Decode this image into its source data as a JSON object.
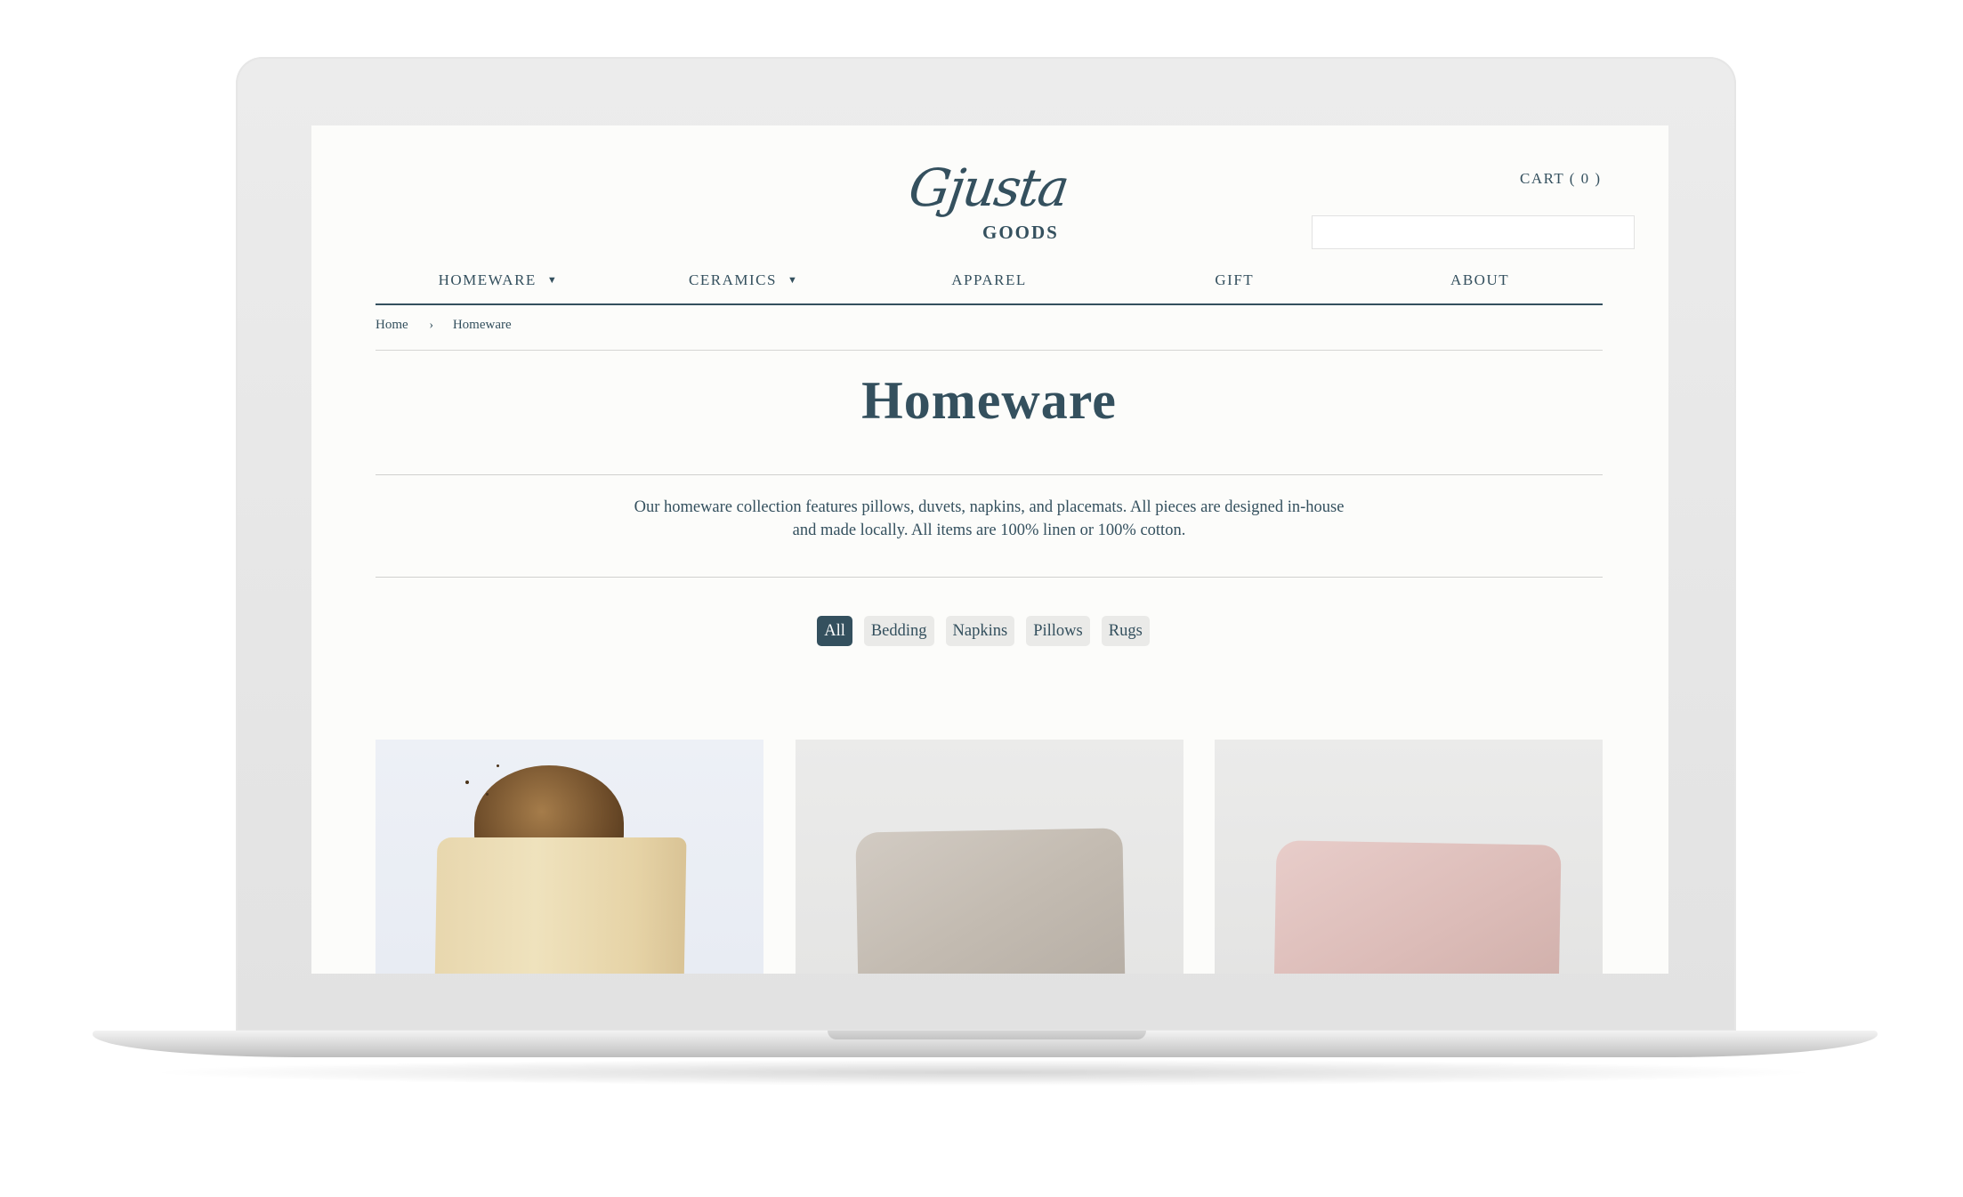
{
  "header": {
    "logo_script": "Gjusta",
    "logo_goods": "GOODS",
    "cart_label": "CART ( 0 )",
    "search_value": ""
  },
  "nav": {
    "items": [
      {
        "label": "HOMEWARE",
        "dropdown": true
      },
      {
        "label": "CERAMICS",
        "dropdown": true
      },
      {
        "label": "APPAREL",
        "dropdown": false
      },
      {
        "label": "GIFT",
        "dropdown": false
      },
      {
        "label": "ABOUT",
        "dropdown": false
      }
    ],
    "caret": "▼"
  },
  "breadcrumb": {
    "home": "Home",
    "separator": "›",
    "current": "Homeware"
  },
  "page": {
    "title": "Homeware",
    "description_line1": "Our homeware collection features pillows, duvets, napkins, and placemats. All pieces are designed in-house",
    "description_line2": "and made locally. All items are 100% linen or 100% cotton."
  },
  "filters": {
    "items": [
      "All",
      "Bedding",
      "Napkins",
      "Pillows",
      "Rugs"
    ],
    "active": "All"
  },
  "colors": {
    "brand": "#34505e",
    "background": "#fcfcfa",
    "tag_bg": "#eaeae8"
  }
}
